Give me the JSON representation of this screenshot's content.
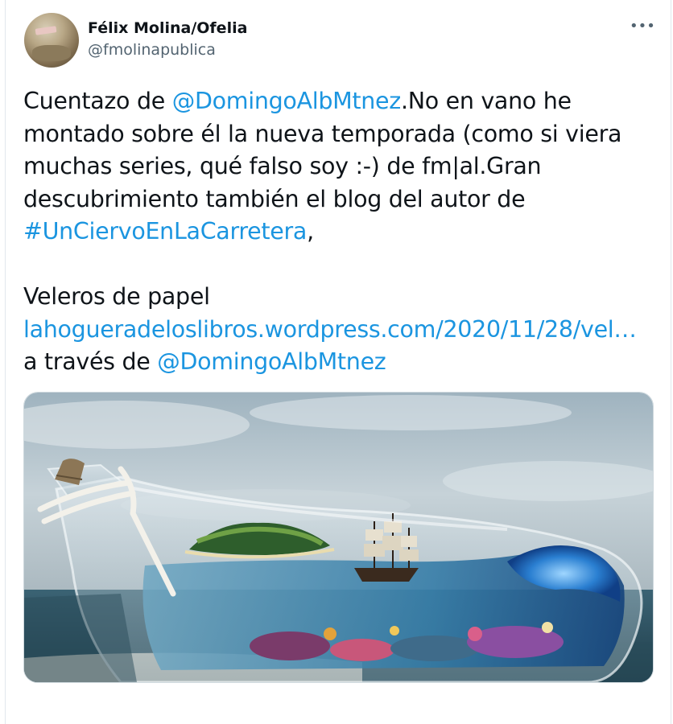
{
  "author": {
    "display_name": "Félix Molina/Ofelia",
    "handle": "@fmolinapublica"
  },
  "actions": {
    "more_label": "•••"
  },
  "tweet": {
    "p1": "Cuentazo de ",
    "mention1": "@DomingoAlbMtnez",
    "p2": ".No en vano he\nmontado sobre él la nueva temporada (como si viera\nmuchas series, qué falso soy :-) de fm|al.Gran\ndescubrimiento también el blog del autor de\n",
    "hashtag": "#UnCiervoEnLaCarretera",
    "p3": ",\n\nVeleros de papel\n",
    "url": "lahogueradeloslibros.wordpress.com/2020/11/28/vel…",
    "p4": "\na través de ",
    "mention2": "@DomingoAlbMtnez"
  },
  "colors": {
    "link": "#1b95e0",
    "text": "#0f1419",
    "secondary": "#536471"
  }
}
